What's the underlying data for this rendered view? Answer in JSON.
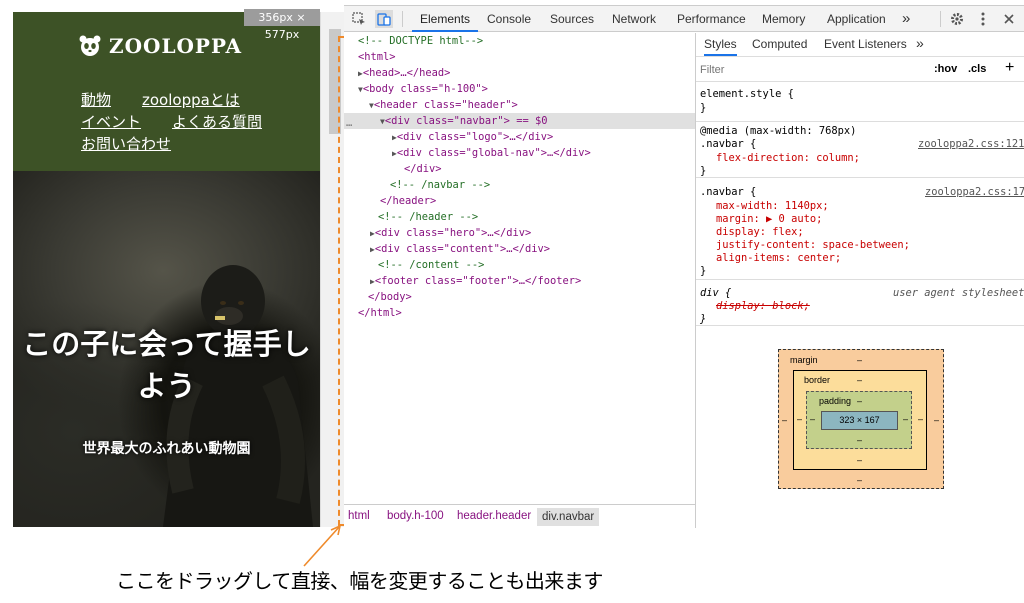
{
  "site": {
    "logo_text": "ZOOLOPPA",
    "nav": [
      "動物",
      "zooloppaとは",
      "イベント",
      "よくある質問",
      "お問い合わせ"
    ],
    "hero_title_line1": "この子に会って握手し",
    "hero_title_line2": "よう",
    "hero_subtitle": "世界最大のふれあい動物園",
    "viewport_badge": "356px × 577px"
  },
  "devtools": {
    "tabs": [
      "Elements",
      "Console",
      "Sources",
      "Network",
      "Performance",
      "Memory",
      "Application"
    ],
    "more_tabs": "»",
    "dom_lines": [
      "<!-- DOCTYPE html-->",
      "<html>",
      "<head>…</head>",
      "<body class=\"h-100\">",
      "<header class=\"header\">",
      "<div class=\"navbar\"> == $0",
      "<div class=\"logo\">…</div>",
      "<div class=\"global-nav\">…</div>",
      "</div>",
      "<!-- /navbar -->",
      "</header>",
      "<!-- /header -->",
      "<div class=\"hero\">…</div>",
      "<div class=\"content\">…</div>",
      "<!-- /content -->",
      "<footer class=\"footer\">…</footer>",
      "</body>",
      "</html>"
    ],
    "breadcrumbs": [
      "html",
      "body.h-100",
      "header.header",
      "div.navbar"
    ],
    "styles_tabs": [
      "Styles",
      "Computed",
      "Event Listeners",
      "»"
    ],
    "filter_placeholder": "Filter",
    "hov": ":hov",
    "cls": ".cls",
    "rules": {
      "element_style": "element.style {",
      "media": "@media (max-width: 768px)",
      "navbar_sel": ".navbar {",
      "src_121": "zooloppa2.css:121",
      "flex_direction": "flex-direction: column;",
      "src_17": "zooloppa2.css:17",
      "decl_max_width": "max-width: 1140px;",
      "decl_margin": "margin: ▶ 0 auto;",
      "decl_display": "display: flex;",
      "decl_justify": "justify-content: space-between;",
      "decl_align": "align-items: center;",
      "div_sel": "div {",
      "ua": "user agent stylesheet",
      "ua_decl": "display: block;",
      "close": "}"
    },
    "box_model": {
      "margin": "margin",
      "border": "border",
      "padding": "padding",
      "content": "323 × 167",
      "dash": "–"
    }
  },
  "caption": "ここをドラッグして直接、幅を変更することも出来ます",
  "colors": {
    "site_header": "#3d5226",
    "drag_highlight": "#ef8a2b",
    "active_tab": "#1a73e8"
  }
}
